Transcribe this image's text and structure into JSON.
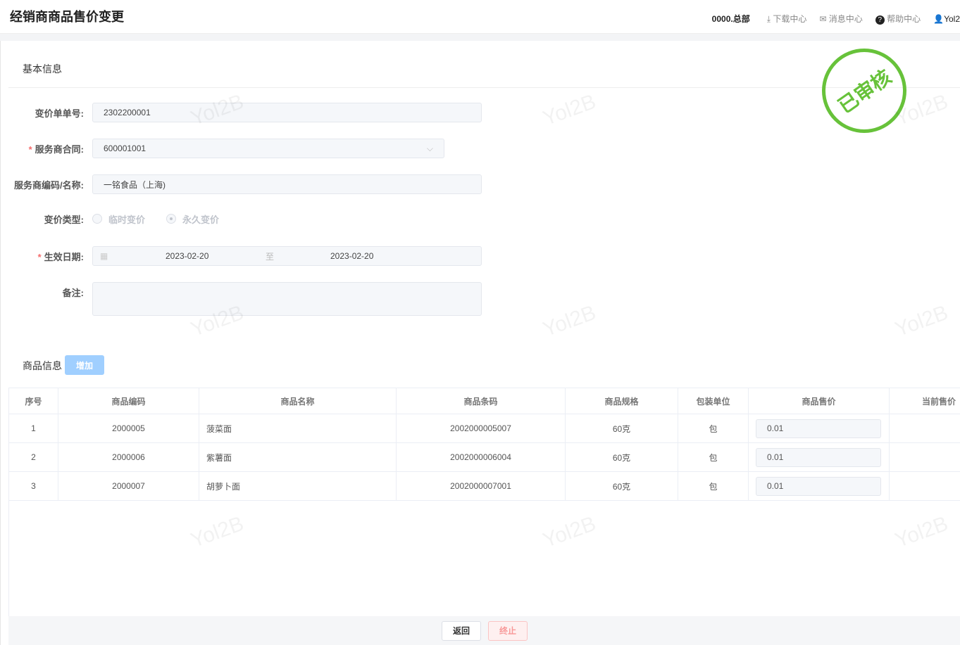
{
  "header": {
    "title": "经销商商品售价变更",
    "org": "0000.总部",
    "download": "下载中心",
    "messages": "消息中心",
    "help": "帮助中心",
    "user": "Yol2"
  },
  "stamp": "已审核",
  "watermark": "Yol2B",
  "basic": {
    "section_title": "基本信息",
    "order_no_label": "变价单单号:",
    "order_no": "2302200001",
    "contract_label": "服务商合同:",
    "contract": "600001001",
    "provider_label": "服务商编码/名称:",
    "provider": "一铭食品（上海)",
    "type_label": "变价类型:",
    "type_options": [
      "临时变价",
      "永久变价"
    ],
    "type_selected": "永久变价",
    "date_label": "生效日期:",
    "date_start": "2023-02-20",
    "date_sep": "至",
    "date_end": "2023-02-20",
    "remark_label": "备注:",
    "remark": ""
  },
  "goods": {
    "section_title": "商品信息",
    "add_label": "增加",
    "columns": [
      "序号",
      "商品编码",
      "商品名称",
      "商品条码",
      "商品规格",
      "包装单位",
      "商品售价",
      "当前售价"
    ],
    "rows": [
      {
        "idx": "1",
        "code": "2000005",
        "name": "菠菜面",
        "barcode": "2002000005007",
        "spec": "60克",
        "unit": "包",
        "price": "0.01",
        "current": ""
      },
      {
        "idx": "2",
        "code": "2000006",
        "name": "紫薯面",
        "barcode": "2002000006004",
        "spec": "60克",
        "unit": "包",
        "price": "0.01",
        "current": ""
      },
      {
        "idx": "3",
        "code": "2000007",
        "name": "胡萝卜面",
        "barcode": "2002000007001",
        "spec": "60克",
        "unit": "包",
        "price": "0.01",
        "current": ""
      }
    ]
  },
  "footer": {
    "back": "返回",
    "terminate": "终止"
  }
}
